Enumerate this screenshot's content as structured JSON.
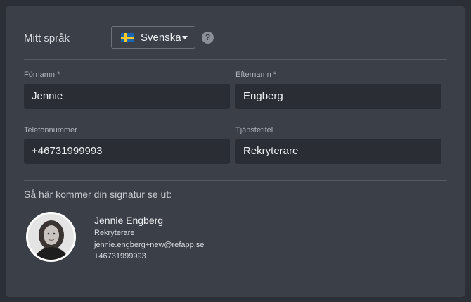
{
  "language": {
    "label": "Mitt språk",
    "selected": "Svenska",
    "flag_icon": "sweden-flag-icon",
    "help_icon": "question-circle-icon"
  },
  "fields": {
    "first_name": {
      "label": "Förnamn *",
      "value": "Jennie"
    },
    "last_name": {
      "label": "Efternamn *",
      "value": "Engberg"
    },
    "phone": {
      "label": "Telefonnummer",
      "value": "+46731999993"
    },
    "title": {
      "label": "Tjänstetitel",
      "value": "Rekryterare"
    }
  },
  "signature": {
    "heading": "Så här kommer din signatur se ut:",
    "name": "Jennie Engberg",
    "title": "Rekryterare",
    "email": "jennie.engberg+new@refapp.se",
    "phone": "+46731999993"
  },
  "colors": {
    "page_bg": "#2c2f36",
    "panel_bg": "#3b3f47",
    "input_bg": "#2a2d33"
  }
}
